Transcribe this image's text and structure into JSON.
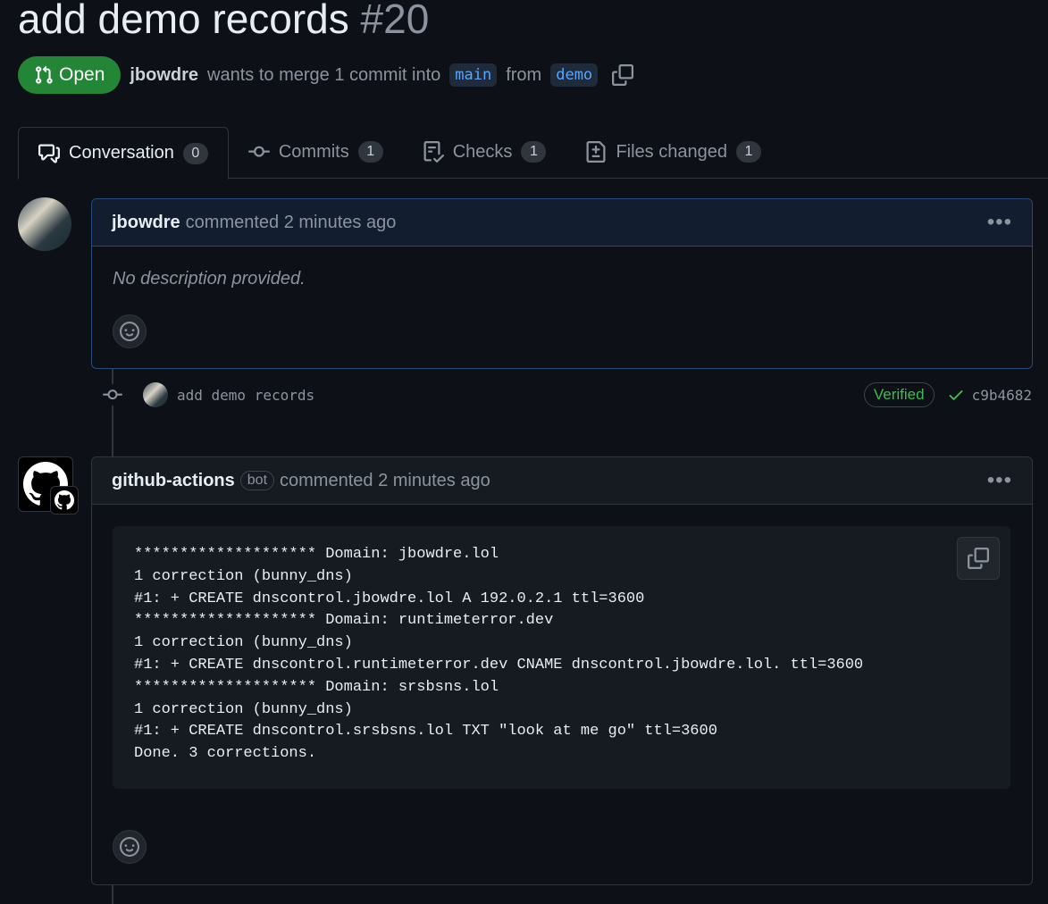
{
  "pr": {
    "title": "add demo records",
    "number": "#20",
    "state": "Open",
    "author": "jbowdre",
    "merge_text": "wants to merge 1 commit into",
    "base_branch": "main",
    "from_text": "from",
    "head_branch": "demo"
  },
  "tabs": [
    {
      "label": "Conversation",
      "count": "0",
      "icon": "comment-discussion-icon"
    },
    {
      "label": "Commits",
      "count": "1",
      "icon": "git-commit-icon"
    },
    {
      "label": "Checks",
      "count": "1",
      "icon": "checklist-icon"
    },
    {
      "label": "Files changed",
      "count": "1",
      "icon": "file-diff-icon"
    }
  ],
  "comment1": {
    "author": "jbowdre",
    "meta": "commented 2 minutes ago",
    "body": "No description provided."
  },
  "commit": {
    "message": "add demo records",
    "verified": "Verified",
    "sha": "c9b4682"
  },
  "comment2": {
    "author": "github-actions",
    "tag": "bot",
    "meta": "commented 2 minutes ago",
    "code": "******************** Domain: jbowdre.lol\n1 correction (bunny_dns)\n#1: + CREATE dnscontrol.jbowdre.lol A 192.0.2.1 ttl=3600\n******************** Domain: runtimeterror.dev\n1 correction (bunny_dns)\n#1: + CREATE dnscontrol.runtimeterror.dev CNAME dnscontrol.jbowdre.lol. ttl=3600\n******************** Domain: srsbsns.lol\n1 correction (bunny_dns)\n#1: + CREATE dnscontrol.srsbsns.lol TXT \"look at me go\" ttl=3600\nDone. 3 corrections."
  },
  "colors": {
    "open_green": "#238636",
    "link_blue": "#58a6ff",
    "verified_green": "#3fb950",
    "background": "#0d1117"
  }
}
